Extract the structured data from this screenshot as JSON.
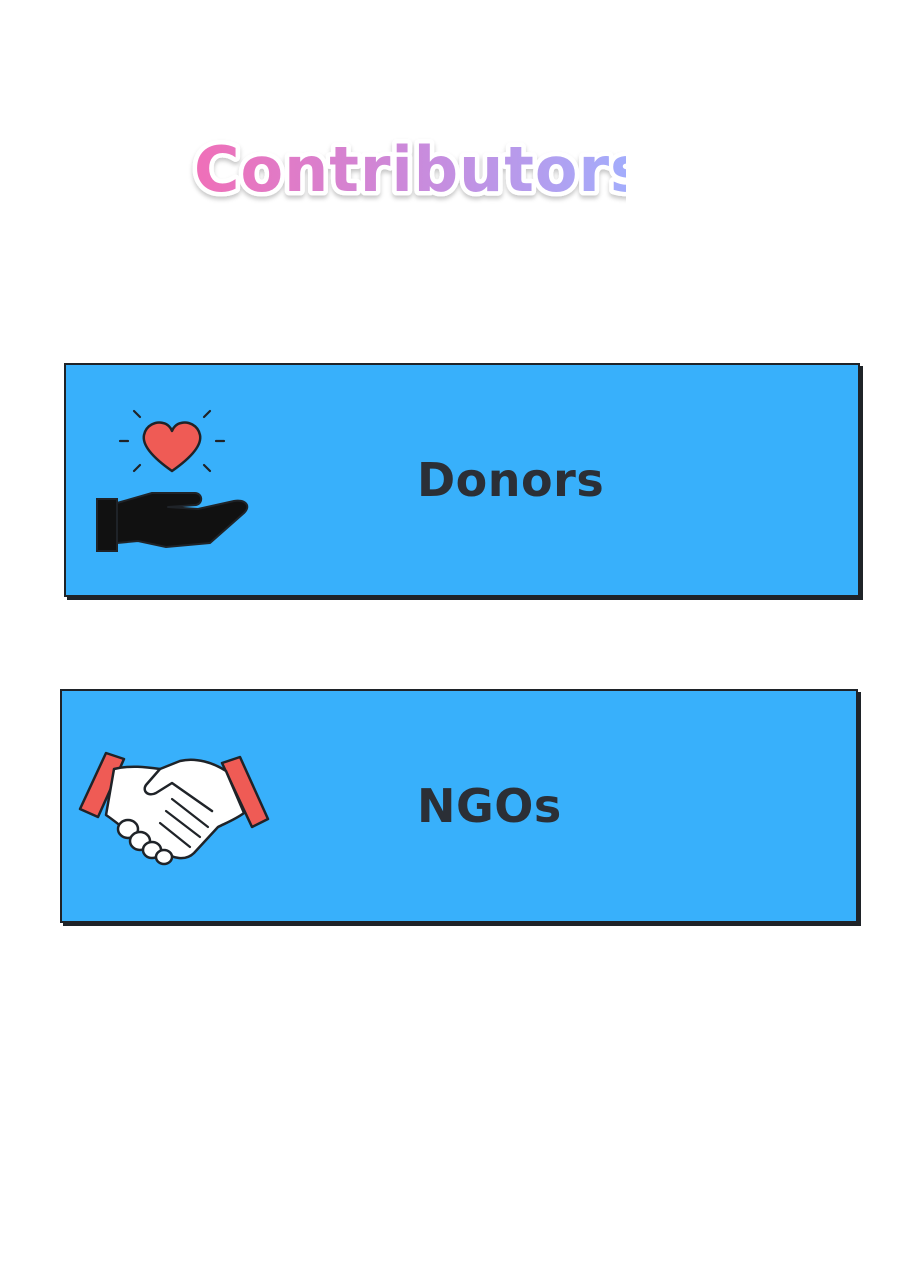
{
  "page": {
    "title": "Contributors"
  },
  "cards": [
    {
      "label": "Donors",
      "icon": "heart-hand-icon"
    },
    {
      "label": "NGOs",
      "icon": "handshake-icon"
    }
  ],
  "colors": {
    "card_background": "#38b0fb",
    "card_border": "#1f2328",
    "label_text": "#2b2f36",
    "title_gradient_start": "#f06fb8",
    "title_gradient_end": "#9fb0ff",
    "icon_red": "#ef5b55"
  }
}
